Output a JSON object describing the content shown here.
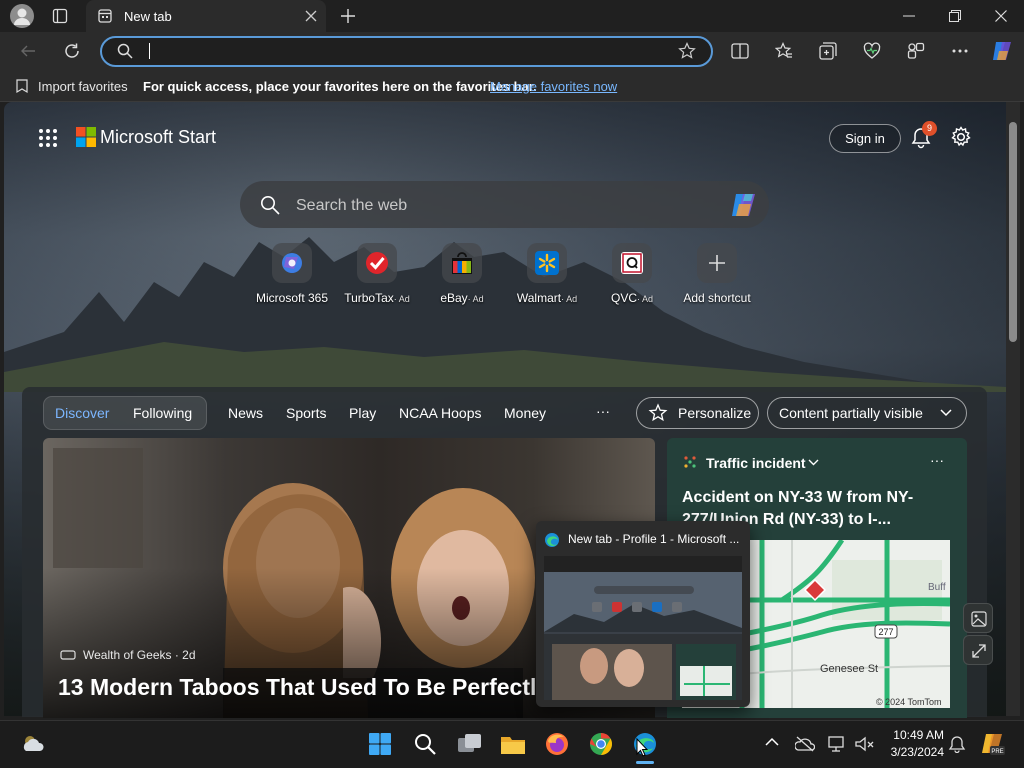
{
  "browser": {
    "tab_title": "New tab",
    "address_value": "",
    "favorites_bar": {
      "import_label": "Import favorites",
      "hint": "For quick access, place your favorites here on the favorites bar.",
      "manage_link": "Manage favorites now"
    }
  },
  "start": {
    "brand": "Microsoft Start",
    "sign_in": "Sign in",
    "notification_count": "9",
    "search_placeholder": "Search the web",
    "shortcuts": [
      {
        "label": "Microsoft 365",
        "ad": ""
      },
      {
        "label": "TurboTax",
        "ad": "· Ad"
      },
      {
        "label": "eBay",
        "ad": "· Ad"
      },
      {
        "label": "Walmart",
        "ad": "· Ad"
      },
      {
        "label": "QVC",
        "ad": "· Ad"
      },
      {
        "label": "Add shortcut",
        "ad": ""
      }
    ],
    "feed_nav": {
      "discover": "Discover",
      "following": "Following",
      "items": [
        "News",
        "Sports",
        "Play",
        "NCAA Hoops",
        "Money"
      ],
      "more": "···",
      "personalize": "Personalize",
      "visibility": "Content partially visible"
    },
    "hero": {
      "source": "Wealth of Geeks · 2d",
      "title": "13 Modern Taboos That Used To Be Perfectly"
    },
    "traffic": {
      "label": "Traffic incident",
      "more": "···",
      "headline": "Accident on NY-33 W from NY-277/Union Rd (NY-33) to I-...",
      "road_shield": "277",
      "street": "Genesee St",
      "place": "Buff",
      "credit": "© 2024 TomTom"
    }
  },
  "preview": {
    "title": "New tab - Profile 1 - Microsoft ..."
  },
  "taskbar": {
    "time": "10:49 AM",
    "date": "3/23/2024"
  },
  "colors": {
    "accent": "#5a9ad8",
    "link": "#79b8ff",
    "badge": "#e0502a",
    "traffic_card": "#24403a",
    "map_road": "#2bb673"
  }
}
